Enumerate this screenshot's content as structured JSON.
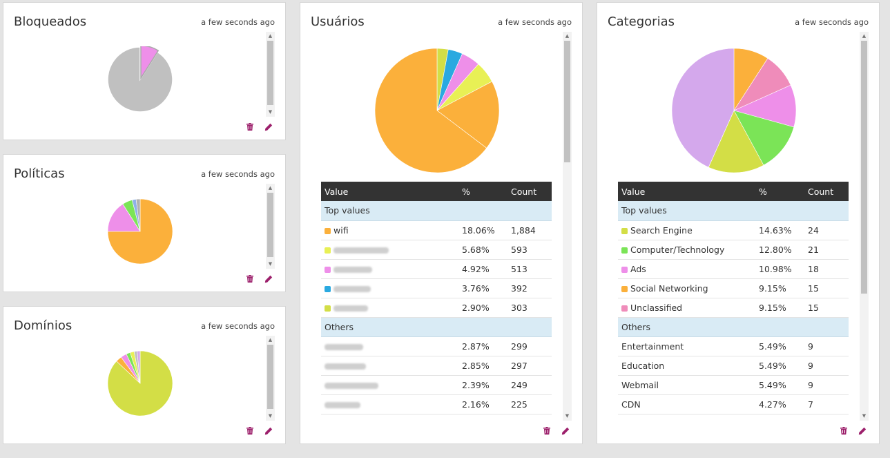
{
  "panels": {
    "bloqueados": {
      "title": "Bloqueados",
      "time": "a few seconds ago",
      "pie": [
        {
          "value": 91,
          "color": "#c0c0c0"
        },
        {
          "value": 9,
          "color": "#ee8fe9"
        }
      ]
    },
    "politicas": {
      "title": "Políticas",
      "time": "a few seconds ago",
      "pie": [
        {
          "value": 75,
          "color": "#fbb03b"
        },
        {
          "value": 16,
          "color": "#ee8fe9"
        },
        {
          "value": 5,
          "color": "#7be457"
        },
        {
          "value": 2,
          "color": "#8fb0e8"
        },
        {
          "value": 2,
          "color": "#b0b0b0"
        }
      ]
    },
    "dominios": {
      "title": "Domínios",
      "time": "a few seconds ago",
      "pie": [
        {
          "value": 87,
          "color": "#d3de46"
        },
        {
          "value": 3,
          "color": "#fbb03b"
        },
        {
          "value": 3,
          "color": "#ee8fe9"
        },
        {
          "value": 2,
          "color": "#7be457"
        },
        {
          "value": 2,
          "color": "#e8f055"
        },
        {
          "value": 1.5,
          "color": "#c0c0c0"
        },
        {
          "value": 1.5,
          "color": "#d4a8ec"
        }
      ]
    },
    "usuarios": {
      "title": "Usuários",
      "time": "a few seconds ago",
      "pie": [
        {
          "value": 2.9,
          "color": "#d3de46"
        },
        {
          "value": 3.76,
          "color": "#2aa9e0"
        },
        {
          "value": 4.92,
          "color": "#ee8fe9"
        },
        {
          "value": 5.68,
          "color": "#e8f055"
        },
        {
          "value": 18.06,
          "color": "#fbb03b"
        },
        {
          "value": 64.68,
          "color": "#fbb03b"
        }
      ],
      "table": {
        "headers": [
          "Value",
          "%",
          "Count"
        ],
        "top_label": "Top values",
        "others_label": "Others",
        "top": [
          {
            "value": "wifi",
            "color": "#fbb03b",
            "pct": "18.06%",
            "count": "1,884",
            "blurred": false
          },
          {
            "value": "",
            "color": "#e8f055",
            "pct": "5.68%",
            "count": "593",
            "blurred": true
          },
          {
            "value": "",
            "color": "#ee8fe9",
            "pct": "4.92%",
            "count": "513",
            "blurred": true
          },
          {
            "value": "",
            "color": "#2aa9e0",
            "pct": "3.76%",
            "count": "392",
            "blurred": true
          },
          {
            "value": "",
            "color": "#d3de46",
            "pct": "2.90%",
            "count": "303",
            "blurred": true
          }
        ],
        "others": [
          {
            "value": "",
            "pct": "2.87%",
            "count": "299"
          },
          {
            "value": "",
            "pct": "2.85%",
            "count": "297"
          },
          {
            "value": "",
            "pct": "2.39%",
            "count": "249"
          },
          {
            "value": "",
            "pct": "2.16%",
            "count": "225"
          }
        ]
      }
    },
    "categorias": {
      "title": "Categorias",
      "time": "a few seconds ago",
      "pie": [
        {
          "value": 9.15,
          "color": "#fbb03b"
        },
        {
          "value": 9.15,
          "color": "#ef8cba"
        },
        {
          "value": 10.98,
          "color": "#ee8fe9"
        },
        {
          "value": 12.8,
          "color": "#7be457"
        },
        {
          "value": 14.63,
          "color": "#d3de46"
        },
        {
          "value": 43.29,
          "color": "#d4a8ec"
        }
      ],
      "table": {
        "headers": [
          "Value",
          "%",
          "Count"
        ],
        "top_label": "Top values",
        "others_label": "Others",
        "top": [
          {
            "value": "Search Engine",
            "color": "#d3de46",
            "pct": "14.63%",
            "count": "24"
          },
          {
            "value": "Computer/Technology",
            "color": "#7be457",
            "pct": "12.80%",
            "count": "21"
          },
          {
            "value": "Ads",
            "color": "#ee8fe9",
            "pct": "10.98%",
            "count": "18"
          },
          {
            "value": "Social Networking",
            "color": "#fbb03b",
            "pct": "9.15%",
            "count": "15"
          },
          {
            "value": "Unclassified",
            "color": "#ef8cba",
            "pct": "9.15%",
            "count": "15"
          }
        ],
        "others": [
          {
            "value": "Entertainment",
            "pct": "5.49%",
            "count": "9"
          },
          {
            "value": "Education",
            "pct": "5.49%",
            "count": "9"
          },
          {
            "value": "Webmail",
            "pct": "5.49%",
            "count": "9"
          },
          {
            "value": "CDN",
            "pct": "4.27%",
            "count": "7"
          }
        ]
      }
    }
  },
  "icons": {
    "delete": "trash-icon",
    "edit": "pencil-icon"
  },
  "accent_color": "#9c1f6b"
}
